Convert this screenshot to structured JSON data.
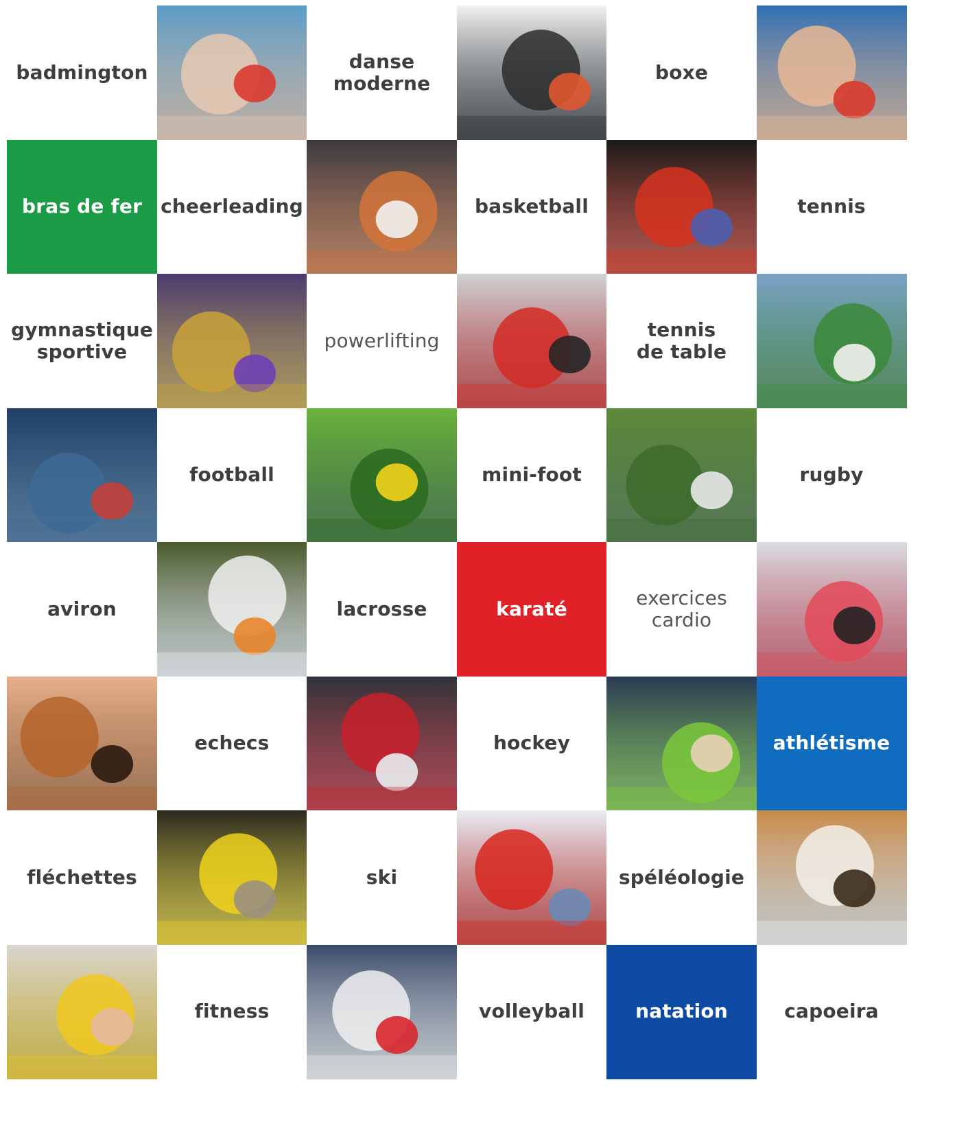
{
  "tiles": [
    {
      "kind": "word",
      "label": "badmington",
      "style": "dark"
    },
    {
      "kind": "image",
      "icon": "badminton-photo",
      "palette": {
        "bg": "#5a9bc7",
        "a": "#e7c9b1",
        "b": "#d93a2f"
      }
    },
    {
      "kind": "word",
      "label": "danse\nmoderne",
      "style": "dark"
    },
    {
      "kind": "image",
      "icon": "dancer-photo",
      "palette": {
        "bg": "#f2f2f2",
        "a": "#2b2b2b",
        "b": "#e0562f"
      }
    },
    {
      "kind": "word",
      "label": "boxe",
      "style": "dark"
    },
    {
      "kind": "image",
      "icon": "table-tennis-photo",
      "palette": {
        "bg": "#2f6fb5",
        "a": "#e8b894",
        "b": "#d83a2c"
      }
    },
    {
      "kind": "word",
      "label": "bras de fer",
      "style": "green"
    },
    {
      "kind": "word",
      "label": "cheerleading",
      "style": "dark"
    },
    {
      "kind": "image",
      "icon": "basketball-photo",
      "palette": {
        "bg": "#3a3a42",
        "a": "#d2743a",
        "b": "#f2f2f2"
      }
    },
    {
      "kind": "word",
      "label": "basketball",
      "style": "dark"
    },
    {
      "kind": "image",
      "icon": "boxing-gloves-photo",
      "palette": {
        "bg": "#1a1a1a",
        "a": "#d7331f",
        "b": "#4b5fb0"
      }
    },
    {
      "kind": "word",
      "label": "tennis",
      "style": "dark"
    },
    {
      "kind": "word",
      "label": "gymnastique\nsportive",
      "style": "dark"
    },
    {
      "kind": "image",
      "icon": "cheerleader-photo",
      "palette": {
        "bg": "#4a3a70",
        "a": "#c9a23a",
        "b": "#6b3fb5"
      }
    },
    {
      "kind": "word",
      "label": "powerlifting",
      "style": "light"
    },
    {
      "kind": "image",
      "icon": "powerlifting-photo",
      "palette": {
        "bg": "#cfd3d6",
        "a": "#d32a25",
        "b": "#262626"
      }
    },
    {
      "kind": "word",
      "label": "tennis\nde table",
      "style": "dark"
    },
    {
      "kind": "image",
      "icon": "tennis-player-photo",
      "palette": {
        "bg": "#7aa2c7",
        "a": "#3a8a3a",
        "b": "#f1f1f1"
      }
    },
    {
      "kind": "image",
      "icon": "rowing-photo",
      "palette": {
        "bg": "#1f3f66",
        "a": "#3c6a95",
        "b": "#c2403a"
      }
    },
    {
      "kind": "word",
      "label": "football",
      "style": "dark"
    },
    {
      "kind": "image",
      "icon": "football-photo",
      "palette": {
        "bg": "#6bb43c",
        "a": "#2a6a1e",
        "b": "#f2d21c"
      }
    },
    {
      "kind": "word",
      "label": "mini-foot",
      "style": "dark"
    },
    {
      "kind": "image",
      "icon": "rugby-ball-photo",
      "palette": {
        "bg": "#5e8a3a",
        "a": "#3d6b2a",
        "b": "#e8e8e8"
      }
    },
    {
      "kind": "word",
      "label": "rugby",
      "style": "dark"
    },
    {
      "kind": "word",
      "label": "aviron",
      "style": "dark"
    },
    {
      "kind": "image",
      "icon": "lacrosse-stick-photo",
      "palette": {
        "bg": "#4a5a2a",
        "a": "#f0f0f0",
        "b": "#e8852a"
      }
    },
    {
      "kind": "word",
      "label": "lacrosse",
      "style": "dark"
    },
    {
      "kind": "word",
      "label": "karaté",
      "style": "red"
    },
    {
      "kind": "word",
      "label": "exercices cardio",
      "style": "light"
    },
    {
      "kind": "image",
      "icon": "spinning-class-photo",
      "palette": {
        "bg": "#d8dde2",
        "a": "#e34a5a",
        "b": "#222222"
      }
    },
    {
      "kind": "image",
      "icon": "chess-photo",
      "palette": {
        "bg": "#e6b08a",
        "a": "#b5642a",
        "b": "#2a1a10"
      }
    },
    {
      "kind": "word",
      "label": "echecs",
      "style": "dark"
    },
    {
      "kind": "image",
      "icon": "hockey-photo",
      "palette": {
        "bg": "#30343a",
        "a": "#c8202a",
        "b": "#e8ecf0"
      }
    },
    {
      "kind": "word",
      "label": "hockey",
      "style": "dark"
    },
    {
      "kind": "image",
      "icon": "fitness-roller-photo",
      "palette": {
        "bg": "#2a3a55",
        "a": "#7ac83a",
        "b": "#e8d0b8"
      }
    },
    {
      "kind": "word",
      "label": "athlétisme",
      "style": "blue"
    },
    {
      "kind": "word",
      "label": "fléchettes",
      "style": "dark"
    },
    {
      "kind": "image",
      "icon": "darts-photo",
      "palette": {
        "bg": "#2a2a20",
        "a": "#f0d21c",
        "b": "#9a9080"
      }
    },
    {
      "kind": "word",
      "label": "ski",
      "style": "dark"
    },
    {
      "kind": "image",
      "icon": "skier-photo",
      "palette": {
        "bg": "#e8eef5",
        "a": "#d8261e",
        "b": "#6a8ab5"
      }
    },
    {
      "kind": "word",
      "label": "spéléologie",
      "style": "dark"
    },
    {
      "kind": "image",
      "icon": "capoeira-photo",
      "palette": {
        "bg": "#c98a4a",
        "a": "#f2f0ea",
        "b": "#3a2a1a"
      }
    },
    {
      "kind": "image",
      "icon": "aerobics-photo",
      "palette": {
        "bg": "#d8d4d0",
        "a": "#f0c81e",
        "b": "#e8b8a0"
      }
    },
    {
      "kind": "word",
      "label": "fitness",
      "style": "dark"
    },
    {
      "kind": "image",
      "icon": "volleyball-photo",
      "palette": {
        "bg": "#3a4a6a",
        "a": "#f0f0f0",
        "b": "#d8262e"
      }
    },
    {
      "kind": "word",
      "label": "volleyball",
      "style": "dark"
    },
    {
      "kind": "word",
      "label": "natation",
      "style": "navy"
    },
    {
      "kind": "word",
      "label": "capoeira",
      "style": "dark"
    }
  ]
}
